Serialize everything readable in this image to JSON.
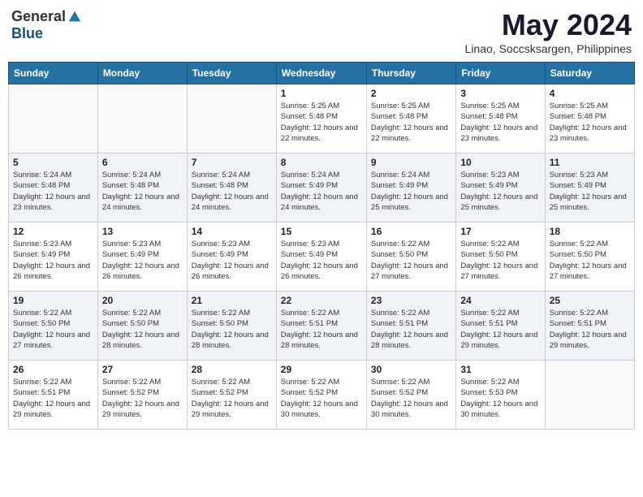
{
  "header": {
    "logo_general": "General",
    "logo_blue": "Blue",
    "month": "May 2024",
    "location": "Linao, Soccsksargen, Philippines"
  },
  "weekdays": [
    "Sunday",
    "Monday",
    "Tuesday",
    "Wednesday",
    "Thursday",
    "Friday",
    "Saturday"
  ],
  "weeks": [
    [
      {
        "day": "",
        "empty": true
      },
      {
        "day": "",
        "empty": true
      },
      {
        "day": "",
        "empty": true
      },
      {
        "day": "1",
        "sunrise": "5:25 AM",
        "sunset": "5:48 PM",
        "daylight": "12 hours and 22 minutes."
      },
      {
        "day": "2",
        "sunrise": "5:25 AM",
        "sunset": "5:48 PM",
        "daylight": "12 hours and 22 minutes."
      },
      {
        "day": "3",
        "sunrise": "5:25 AM",
        "sunset": "5:48 PM",
        "daylight": "12 hours and 23 minutes."
      },
      {
        "day": "4",
        "sunrise": "5:25 AM",
        "sunset": "5:48 PM",
        "daylight": "12 hours and 23 minutes."
      }
    ],
    [
      {
        "day": "5",
        "sunrise": "5:24 AM",
        "sunset": "5:48 PM",
        "daylight": "12 hours and 23 minutes."
      },
      {
        "day": "6",
        "sunrise": "5:24 AM",
        "sunset": "5:48 PM",
        "daylight": "12 hours and 24 minutes."
      },
      {
        "day": "7",
        "sunrise": "5:24 AM",
        "sunset": "5:48 PM",
        "daylight": "12 hours and 24 minutes."
      },
      {
        "day": "8",
        "sunrise": "5:24 AM",
        "sunset": "5:49 PM",
        "daylight": "12 hours and 24 minutes."
      },
      {
        "day": "9",
        "sunrise": "5:24 AM",
        "sunset": "5:49 PM",
        "daylight": "12 hours and 25 minutes."
      },
      {
        "day": "10",
        "sunrise": "5:23 AM",
        "sunset": "5:49 PM",
        "daylight": "12 hours and 25 minutes."
      },
      {
        "day": "11",
        "sunrise": "5:23 AM",
        "sunset": "5:49 PM",
        "daylight": "12 hours and 25 minutes."
      }
    ],
    [
      {
        "day": "12",
        "sunrise": "5:23 AM",
        "sunset": "5:49 PM",
        "daylight": "12 hours and 26 minutes."
      },
      {
        "day": "13",
        "sunrise": "5:23 AM",
        "sunset": "5:49 PM",
        "daylight": "12 hours and 26 minutes."
      },
      {
        "day": "14",
        "sunrise": "5:23 AM",
        "sunset": "5:49 PM",
        "daylight": "12 hours and 26 minutes."
      },
      {
        "day": "15",
        "sunrise": "5:23 AM",
        "sunset": "5:49 PM",
        "daylight": "12 hours and 26 minutes."
      },
      {
        "day": "16",
        "sunrise": "5:22 AM",
        "sunset": "5:50 PM",
        "daylight": "12 hours and 27 minutes."
      },
      {
        "day": "17",
        "sunrise": "5:22 AM",
        "sunset": "5:50 PM",
        "daylight": "12 hours and 27 minutes."
      },
      {
        "day": "18",
        "sunrise": "5:22 AM",
        "sunset": "5:50 PM",
        "daylight": "12 hours and 27 minutes."
      }
    ],
    [
      {
        "day": "19",
        "sunrise": "5:22 AM",
        "sunset": "5:50 PM",
        "daylight": "12 hours and 27 minutes."
      },
      {
        "day": "20",
        "sunrise": "5:22 AM",
        "sunset": "5:50 PM",
        "daylight": "12 hours and 28 minutes."
      },
      {
        "day": "21",
        "sunrise": "5:22 AM",
        "sunset": "5:50 PM",
        "daylight": "12 hours and 28 minutes."
      },
      {
        "day": "22",
        "sunrise": "5:22 AM",
        "sunset": "5:51 PM",
        "daylight": "12 hours and 28 minutes."
      },
      {
        "day": "23",
        "sunrise": "5:22 AM",
        "sunset": "5:51 PM",
        "daylight": "12 hours and 28 minutes."
      },
      {
        "day": "24",
        "sunrise": "5:22 AM",
        "sunset": "5:51 PM",
        "daylight": "12 hours and 29 minutes."
      },
      {
        "day": "25",
        "sunrise": "5:22 AM",
        "sunset": "5:51 PM",
        "daylight": "12 hours and 29 minutes."
      }
    ],
    [
      {
        "day": "26",
        "sunrise": "5:22 AM",
        "sunset": "5:51 PM",
        "daylight": "12 hours and 29 minutes."
      },
      {
        "day": "27",
        "sunrise": "5:22 AM",
        "sunset": "5:52 PM",
        "daylight": "12 hours and 29 minutes."
      },
      {
        "day": "28",
        "sunrise": "5:22 AM",
        "sunset": "5:52 PM",
        "daylight": "12 hours and 29 minutes."
      },
      {
        "day": "29",
        "sunrise": "5:22 AM",
        "sunset": "5:52 PM",
        "daylight": "12 hours and 30 minutes."
      },
      {
        "day": "30",
        "sunrise": "5:22 AM",
        "sunset": "5:52 PM",
        "daylight": "12 hours and 30 minutes."
      },
      {
        "day": "31",
        "sunrise": "5:22 AM",
        "sunset": "5:53 PM",
        "daylight": "12 hours and 30 minutes."
      },
      {
        "day": "",
        "empty": true
      }
    ]
  ]
}
